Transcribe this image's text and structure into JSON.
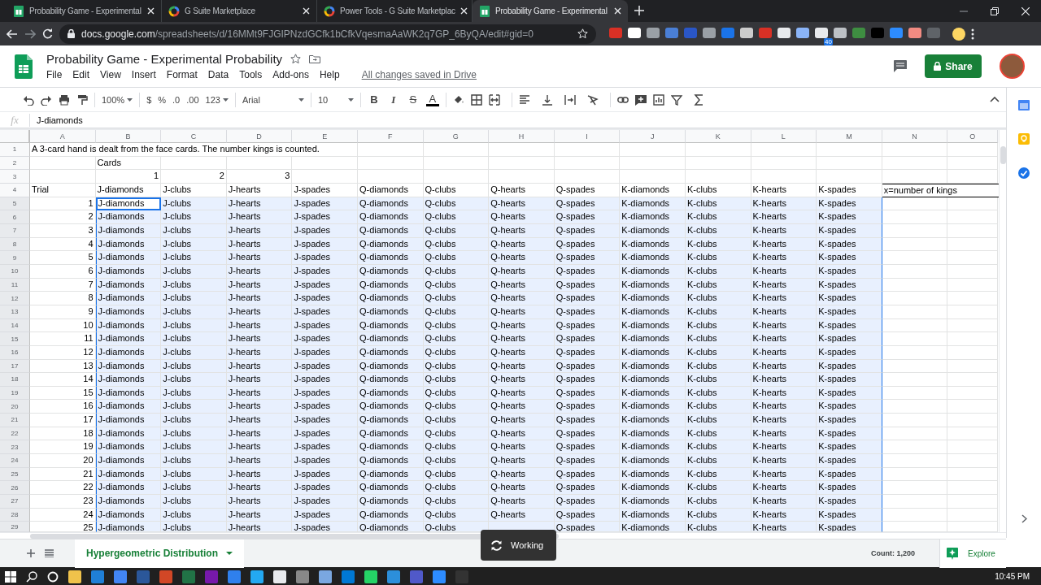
{
  "browser": {
    "tabs": [
      {
        "title": "Probability Game - Experimental",
        "kind": "sheets",
        "selected": false
      },
      {
        "title": "G Suite Marketplace",
        "kind": "google",
        "selected": false
      },
      {
        "title": "Power Tools - G Suite Marketplac",
        "kind": "google",
        "selected": false
      },
      {
        "title": "Probability Game - Experimental",
        "kind": "sheets",
        "selected": true
      }
    ],
    "url": {
      "host": "docs.google.com",
      "path": "/spreadsheets/d/16MMt9FJGIPNzdGCfk1bCfkVqesmaAaWK2q7GP_6ByQA/edit#gid=0"
    },
    "extension_badge": "40"
  },
  "app": {
    "title": "Probability Game - Experimental Probability",
    "menu": [
      "File",
      "Edit",
      "View",
      "Insert",
      "Format",
      "Data",
      "Tools",
      "Add-ons",
      "Help"
    ],
    "save_status": "All changes saved in Drive",
    "share": "Share"
  },
  "toolbar": {
    "zoom": "100%",
    "currency": "$",
    "percent": "%",
    "decrease_decimals": ".0",
    "increase_decimals": ".00",
    "number_format": "123",
    "font": "Arial",
    "font_size": "10",
    "bold": "B",
    "italic": "I",
    "strikethrough": "S",
    "text_color": "A"
  },
  "formula_bar": {
    "label": "fx",
    "value": "J-diamonds"
  },
  "sheet": {
    "columns": [
      "A",
      "B",
      "C",
      "D",
      "E",
      "F",
      "G",
      "H",
      "I",
      "J",
      "K",
      "L",
      "M",
      "N",
      "O"
    ],
    "rows": [
      {
        "number": "1",
        "selected": false,
        "cells": {
          "A": "A 3-card hand is dealt from the face cards.  The number kings is counted."
        }
      },
      {
        "number": "2",
        "selected": false,
        "cells": {
          "B": "Cards"
        }
      },
      {
        "number": "3",
        "selected": false,
        "cells": {
          "B": {
            "text": "1",
            "numeric": true
          },
          "C": {
            "text": "2",
            "numeric": true
          },
          "D": {
            "text": "3",
            "numeric": true
          }
        }
      },
      {
        "number": "4",
        "selected": false,
        "cells": {
          "A": "Trial",
          "B": "J-diamonds",
          "C": "J-clubs",
          "D": "J-hearts",
          "E": "J-spades",
          "F": "Q-diamonds",
          "G": "Q-clubs",
          "H": "Q-hearts",
          "I": "Q-spades",
          "J": "K-diamonds",
          "K": "K-clubs",
          "L": "K-hearts",
          "M": "K-spades",
          "N": {
            "text": "x=number of kings",
            "boxed": true
          }
        }
      },
      {
        "number": "5",
        "selected": true,
        "cells": {
          "A": {
            "text": "1",
            "numeric": true
          },
          "B": {
            "text": "J-diamonds",
            "active": true
          },
          "C": "J-clubs",
          "D": "J-hearts",
          "E": "J-spades",
          "F": "Q-diamonds",
          "G": "Q-clubs",
          "H": "Q-hearts",
          "I": "Q-spades",
          "J": "K-diamonds",
          "K": "K-clubs",
          "L": "K-hearts",
          "M": "K-spades"
        }
      },
      {
        "number": "6",
        "selected": true,
        "cells": {
          "A": {
            "text": "2",
            "numeric": true
          },
          "B": "J-diamonds",
          "C": "J-clubs",
          "D": "J-hearts",
          "E": "J-spades",
          "F": "Q-diamonds",
          "G": "Q-clubs",
          "H": "Q-hearts",
          "I": "Q-spades",
          "J": "K-diamonds",
          "K": "K-clubs",
          "L": "K-hearts",
          "M": "K-spades"
        }
      },
      {
        "number": "7",
        "selected": true,
        "cells": {
          "A": {
            "text": "3",
            "numeric": true
          },
          "B": "J-diamonds",
          "C": "J-clubs",
          "D": "J-hearts",
          "E": "J-spades",
          "F": "Q-diamonds",
          "G": "Q-clubs",
          "H": "Q-hearts",
          "I": "Q-spades",
          "J": "K-diamonds",
          "K": "K-clubs",
          "L": "K-hearts",
          "M": "K-spades"
        }
      },
      {
        "number": "8",
        "selected": true,
        "cells": {
          "A": {
            "text": "4",
            "numeric": true
          },
          "B": "J-diamonds",
          "C": "J-clubs",
          "D": "J-hearts",
          "E": "J-spades",
          "F": "Q-diamonds",
          "G": "Q-clubs",
          "H": "Q-hearts",
          "I": "Q-spades",
          "J": "K-diamonds",
          "K": "K-clubs",
          "L": "K-hearts",
          "M": "K-spades"
        }
      },
      {
        "number": "9",
        "selected": true,
        "cells": {
          "A": {
            "text": "5",
            "numeric": true
          },
          "B": "J-diamonds",
          "C": "J-clubs",
          "D": "J-hearts",
          "E": "J-spades",
          "F": "Q-diamonds",
          "G": "Q-clubs",
          "H": "Q-hearts",
          "I": "Q-spades",
          "J": "K-diamonds",
          "K": "K-clubs",
          "L": "K-hearts",
          "M": "K-spades"
        }
      },
      {
        "number": "10",
        "selected": true,
        "cells": {
          "A": {
            "text": "6",
            "numeric": true
          },
          "B": "J-diamonds",
          "C": "J-clubs",
          "D": "J-hearts",
          "E": "J-spades",
          "F": "Q-diamonds",
          "G": "Q-clubs",
          "H": "Q-hearts",
          "I": "Q-spades",
          "J": "K-diamonds",
          "K": "K-clubs",
          "L": "K-hearts",
          "M": "K-spades"
        }
      },
      {
        "number": "11",
        "selected": true,
        "cells": {
          "A": {
            "text": "7",
            "numeric": true
          },
          "B": "J-diamonds",
          "C": "J-clubs",
          "D": "J-hearts",
          "E": "J-spades",
          "F": "Q-diamonds",
          "G": "Q-clubs",
          "H": "Q-hearts",
          "I": "Q-spades",
          "J": "K-diamonds",
          "K": "K-clubs",
          "L": "K-hearts",
          "M": "K-spades"
        }
      },
      {
        "number": "12",
        "selected": true,
        "cells": {
          "A": {
            "text": "8",
            "numeric": true
          },
          "B": "J-diamonds",
          "C": "J-clubs",
          "D": "J-hearts",
          "E": "J-spades",
          "F": "Q-diamonds",
          "G": "Q-clubs",
          "H": "Q-hearts",
          "I": "Q-spades",
          "J": "K-diamonds",
          "K": "K-clubs",
          "L": "K-hearts",
          "M": "K-spades"
        }
      },
      {
        "number": "13",
        "selected": true,
        "cells": {
          "A": {
            "text": "9",
            "numeric": true
          },
          "B": "J-diamonds",
          "C": "J-clubs",
          "D": "J-hearts",
          "E": "J-spades",
          "F": "Q-diamonds",
          "G": "Q-clubs",
          "H": "Q-hearts",
          "I": "Q-spades",
          "J": "K-diamonds",
          "K": "K-clubs",
          "L": "K-hearts",
          "M": "K-spades"
        }
      },
      {
        "number": "14",
        "selected": true,
        "cells": {
          "A": {
            "text": "10",
            "numeric": true
          },
          "B": "J-diamonds",
          "C": "J-clubs",
          "D": "J-hearts",
          "E": "J-spades",
          "F": "Q-diamonds",
          "G": "Q-clubs",
          "H": "Q-hearts",
          "I": "Q-spades",
          "J": "K-diamonds",
          "K": "K-clubs",
          "L": "K-hearts",
          "M": "K-spades"
        }
      },
      {
        "number": "15",
        "selected": true,
        "cells": {
          "A": {
            "text": "11",
            "numeric": true
          },
          "B": "J-diamonds",
          "C": "J-clubs",
          "D": "J-hearts",
          "E": "J-spades",
          "F": "Q-diamonds",
          "G": "Q-clubs",
          "H": "Q-hearts",
          "I": "Q-spades",
          "J": "K-diamonds",
          "K": "K-clubs",
          "L": "K-hearts",
          "M": "K-spades"
        }
      },
      {
        "number": "16",
        "selected": true,
        "cells": {
          "A": {
            "text": "12",
            "numeric": true
          },
          "B": "J-diamonds",
          "C": "J-clubs",
          "D": "J-hearts",
          "E": "J-spades",
          "F": "Q-diamonds",
          "G": "Q-clubs",
          "H": "Q-hearts",
          "I": "Q-spades",
          "J": "K-diamonds",
          "K": "K-clubs",
          "L": "K-hearts",
          "M": "K-spades"
        }
      },
      {
        "number": "17",
        "selected": true,
        "cells": {
          "A": {
            "text": "13",
            "numeric": true
          },
          "B": "J-diamonds",
          "C": "J-clubs",
          "D": "J-hearts",
          "E": "J-spades",
          "F": "Q-diamonds",
          "G": "Q-clubs",
          "H": "Q-hearts",
          "I": "Q-spades",
          "J": "K-diamonds",
          "K": "K-clubs",
          "L": "K-hearts",
          "M": "K-spades"
        }
      },
      {
        "number": "18",
        "selected": true,
        "cells": {
          "A": {
            "text": "14",
            "numeric": true
          },
          "B": "J-diamonds",
          "C": "J-clubs",
          "D": "J-hearts",
          "E": "J-spades",
          "F": "Q-diamonds",
          "G": "Q-clubs",
          "H": "Q-hearts",
          "I": "Q-spades",
          "J": "K-diamonds",
          "K": "K-clubs",
          "L": "K-hearts",
          "M": "K-spades"
        }
      },
      {
        "number": "19",
        "selected": true,
        "cells": {
          "A": {
            "text": "15",
            "numeric": true
          },
          "B": "J-diamonds",
          "C": "J-clubs",
          "D": "J-hearts",
          "E": "J-spades",
          "F": "Q-diamonds",
          "G": "Q-clubs",
          "H": "Q-hearts",
          "I": "Q-spades",
          "J": "K-diamonds",
          "K": "K-clubs",
          "L": "K-hearts",
          "M": "K-spades"
        }
      },
      {
        "number": "20",
        "selected": true,
        "cells": {
          "A": {
            "text": "16",
            "numeric": true
          },
          "B": "J-diamonds",
          "C": "J-clubs",
          "D": "J-hearts",
          "E": "J-spades",
          "F": "Q-diamonds",
          "G": "Q-clubs",
          "H": "Q-hearts",
          "I": "Q-spades",
          "J": "K-diamonds",
          "K": "K-clubs",
          "L": "K-hearts",
          "M": "K-spades"
        }
      },
      {
        "number": "21",
        "selected": true,
        "cells": {
          "A": {
            "text": "17",
            "numeric": true
          },
          "B": "J-diamonds",
          "C": "J-clubs",
          "D": "J-hearts",
          "E": "J-spades",
          "F": "Q-diamonds",
          "G": "Q-clubs",
          "H": "Q-hearts",
          "I": "Q-spades",
          "J": "K-diamonds",
          "K": "K-clubs",
          "L": "K-hearts",
          "M": "K-spades"
        }
      },
      {
        "number": "22",
        "selected": true,
        "cells": {
          "A": {
            "text": "18",
            "numeric": true
          },
          "B": "J-diamonds",
          "C": "J-clubs",
          "D": "J-hearts",
          "E": "J-spades",
          "F": "Q-diamonds",
          "G": "Q-clubs",
          "H": "Q-hearts",
          "I": "Q-spades",
          "J": "K-diamonds",
          "K": "K-clubs",
          "L": "K-hearts",
          "M": "K-spades"
        }
      },
      {
        "number": "23",
        "selected": true,
        "cells": {
          "A": {
            "text": "19",
            "numeric": true
          },
          "B": "J-diamonds",
          "C": "J-clubs",
          "D": "J-hearts",
          "E": "J-spades",
          "F": "Q-diamonds",
          "G": "Q-clubs",
          "H": "Q-hearts",
          "I": "Q-spades",
          "J": "K-diamonds",
          "K": "K-clubs",
          "L": "K-hearts",
          "M": "K-spades"
        }
      },
      {
        "number": "24",
        "selected": true,
        "cells": {
          "A": {
            "text": "20",
            "numeric": true
          },
          "B": "J-diamonds",
          "C": "J-clubs",
          "D": "J-hearts",
          "E": "J-spades",
          "F": "Q-diamonds",
          "G": "Q-clubs",
          "H": "Q-hearts",
          "I": "Q-spades",
          "J": "K-diamonds",
          "K": "K-clubs",
          "L": "K-hearts",
          "M": "K-spades"
        }
      },
      {
        "number": "25",
        "selected": true,
        "cells": {
          "A": {
            "text": "21",
            "numeric": true
          },
          "B": "J-diamonds",
          "C": "J-clubs",
          "D": "J-hearts",
          "E": "J-spades",
          "F": "Q-diamonds",
          "G": "Q-clubs",
          "H": "Q-hearts",
          "I": "Q-spades",
          "J": "K-diamonds",
          "K": "K-clubs",
          "L": "K-hearts",
          "M": "K-spades"
        }
      },
      {
        "number": "26",
        "selected": true,
        "cells": {
          "A": {
            "text": "22",
            "numeric": true
          },
          "B": "J-diamonds",
          "C": "J-clubs",
          "D": "J-hearts",
          "E": "J-spades",
          "F": "Q-diamonds",
          "G": "Q-clubs",
          "H": "Q-hearts",
          "I": "Q-spades",
          "J": "K-diamonds",
          "K": "K-clubs",
          "L": "K-hearts",
          "M": "K-spades"
        }
      },
      {
        "number": "27",
        "selected": true,
        "cells": {
          "A": {
            "text": "23",
            "numeric": true
          },
          "B": "J-diamonds",
          "C": "J-clubs",
          "D": "J-hearts",
          "E": "J-spades",
          "F": "Q-diamonds",
          "G": "Q-clubs",
          "H": "Q-hearts",
          "I": "Q-spades",
          "J": "K-diamonds",
          "K": "K-clubs",
          "L": "K-hearts",
          "M": "K-spades"
        }
      },
      {
        "number": "28",
        "selected": true,
        "cells": {
          "A": {
            "text": "24",
            "numeric": true
          },
          "B": "J-diamonds",
          "C": "J-clubs",
          "D": "J-hearts",
          "E": "J-spades",
          "F": "Q-diamonds",
          "G": "Q-clubs",
          "H": "Q-hearts",
          "I": "Q-spades",
          "J": "K-diamonds",
          "K": "K-clubs",
          "L": "K-hearts",
          "M": "K-spades"
        }
      },
      {
        "number": "29",
        "selected": true,
        "cells": {
          "A": {
            "text": "25",
            "numeric": true
          },
          "B": "J-diamonds",
          "C": "J-clubs",
          "D": "J-hearts",
          "E": "J-spades",
          "F": "Q-diamonds",
          "G": "Q-clubs",
          "I": "Q-spades",
          "J": "K-diamonds",
          "K": "K-clubs",
          "L": "K-hearts",
          "M": "K-spades"
        }
      }
    ]
  },
  "sheet_tabs": [
    {
      "label": "Hypergeometric Distribution",
      "selected": true
    }
  ],
  "status": {
    "count": "Count: 1,200",
    "explore": "Explore"
  },
  "toast": {
    "text": "Working"
  },
  "taskbar": {
    "time": "10:45 PM"
  }
}
